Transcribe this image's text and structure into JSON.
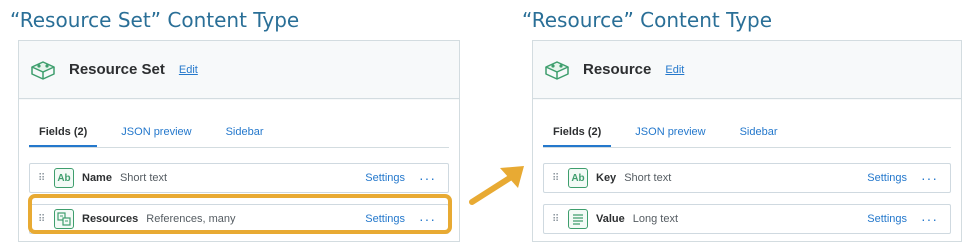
{
  "left": {
    "heading": "“Resource Set” Content Type",
    "title": "Resource Set",
    "edit_label": "Edit",
    "tabs": [
      "Fields (2)",
      "JSON preview",
      "Sidebar"
    ],
    "fields": [
      {
        "icon": "text-ab-icon",
        "icon_text": "Ab",
        "name": "Name",
        "type": "Short text"
      },
      {
        "icon": "references-icon",
        "name": "Resources",
        "type": "References, many"
      }
    ]
  },
  "right": {
    "heading": "“Resource” Content Type",
    "title": "Resource",
    "edit_label": "Edit",
    "tabs": [
      "Fields (2)",
      "JSON preview",
      "Sidebar"
    ],
    "fields": [
      {
        "icon": "text-ab-icon",
        "icon_text": "Ab",
        "name": "Key",
        "type": "Short text"
      },
      {
        "icon": "long-text-icon",
        "name": "Value",
        "type": "Long text"
      }
    ]
  },
  "row_actions": {
    "settings_label": "Settings",
    "more_label": "···"
  },
  "colors": {
    "heading": "#2a6f97",
    "link": "#2478cc",
    "field_icon": "#3e9e6d",
    "highlight": "#e8aa33",
    "arrow": "#e8aa33"
  }
}
